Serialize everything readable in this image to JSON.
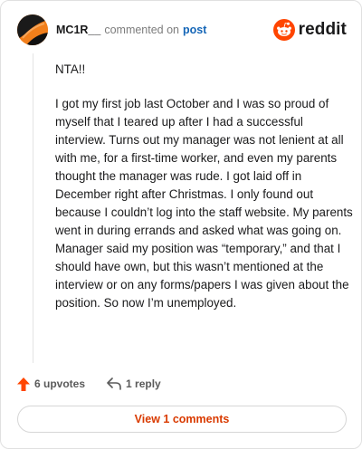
{
  "header": {
    "username": "MC1R__",
    "action": "commented on",
    "post_link": "post",
    "logo_text": "reddit"
  },
  "comment": {
    "paragraphs": [
      "NTA!!",
      "I got my first job last October and I was so proud of myself that I teared up after I had a successful interview. Turns out my manager was not lenient at all with me, for a first-time worker, and even my parents thought the manager was rude. I got laid off in December right after Christmas. I only found out because I couldn’t log into the staff website. My parents went in during errands and asked what was going on. Manager said my position was “temporary,” and that I should have own, but this wasn’t mentioned at the interview or on any forms/papers I was given about the position. So now I’m unemployed."
    ]
  },
  "actions": {
    "upvotes": "6 upvotes",
    "reply": "1 reply"
  },
  "footer": {
    "view_button": "View 1 comments"
  },
  "colors": {
    "brand": "#ff4500",
    "link": "#1566b7",
    "view_button_text": "#d93a00"
  },
  "icons": {
    "avatar": "avatar",
    "logo": "reddit-snoo-icon",
    "upvote": "upvote-arrow-icon",
    "reply": "reply-arrow-icon"
  }
}
